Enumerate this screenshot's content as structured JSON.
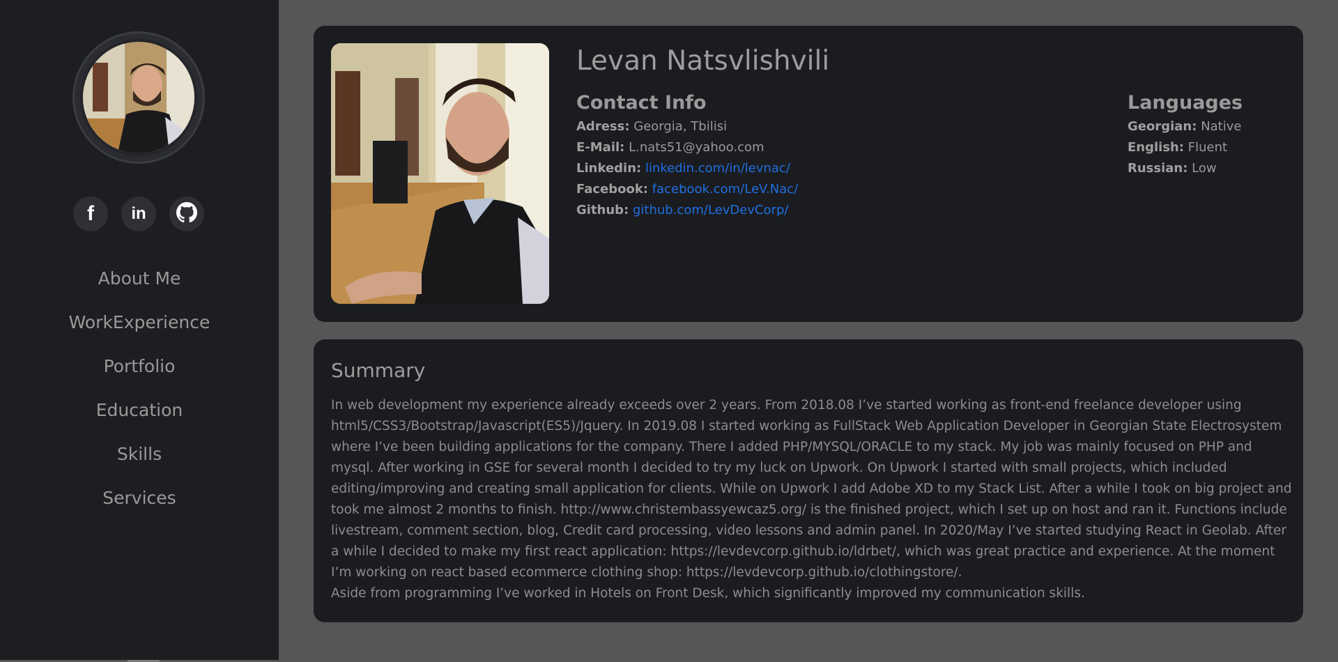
{
  "sidebar": {
    "socials": [
      {
        "icon": "facebook-icon",
        "glyph": "f"
      },
      {
        "icon": "linkedin-icon",
        "glyph": "in"
      },
      {
        "icon": "github-icon"
      }
    ],
    "nav": [
      {
        "label": "About Me"
      },
      {
        "label": "WorkExperience"
      },
      {
        "label": "Portfolio"
      },
      {
        "label": "Education"
      },
      {
        "label": "Skills"
      },
      {
        "label": "Services"
      }
    ]
  },
  "profile": {
    "name": "Levan Natsvlishvili",
    "contact": {
      "title": "Contact Info",
      "adress_label": "Adress:",
      "adress_value": "Georgia, Tbilisi",
      "email_label": "E-Mail:",
      "email_value": "L.nats51@yahoo.com",
      "linkedin_label": "Linkedin:",
      "linkedin_value": "linkedin.com/in/levnac/",
      "facebook_label": "Facebook:",
      "facebook_value": "facebook.com/LeV.Nac/",
      "github_label": "Github:",
      "github_value": "github.com/LevDevCorp/"
    },
    "languages": {
      "title": "Languages",
      "items": [
        {
          "label": "Georgian:",
          "value": "Native"
        },
        {
          "label": "English:",
          "value": "Fluent"
        },
        {
          "label": "Russian:",
          "value": "Low"
        }
      ]
    }
  },
  "summary": {
    "title": "Summary",
    "paragraph1": "In web development my experience already exceeds over 2 years. From 2018.08 I’ve started working as front-end freelance developer using html5/CSS3/Bootstrap/Javascript(ES5)/Jquery. In 2019.08 I started working as FullStack Web Application Developer in Georgian State Electrosystem where I’ve been building applications for the company. There I added PHP/MYSQL/ORACLE to my stack. My job was mainly focused on PHP and mysql. After working in GSE for several month I decided to try my luck on Upwork. On Upwork I started with small projects, which included editing/improving and creating small application for clients. While on Upwork I add Adobe XD to my Stack List. After a while I took on big project and took me almost 2 months to finish. http://www.christembassyewcaz5.org/ is the finished project, which I set up on host and ran it. Functions include livestream, comment section, blog, Credit card processing, video lessons and admin panel. In 2020/May I’ve started studying React in Geolab. After a while I decided to make my first react application: https://levdevcorp.github.io/ldrbet/, which was great practice and experience. At the moment I’m working on react based ecommerce clothing shop: https://levdevcorp.github.io/clothingstore/.",
    "paragraph2": "Aside from programming I’ve worked in Hotels on Front Desk, which significantly improved my communication skills."
  },
  "colors": {
    "page_bg": "#565656",
    "sidebar_bg": "#1d1e21",
    "card_bg": "#1b1c20",
    "link": "#1f6fe0",
    "text": "#9a9a9a"
  }
}
